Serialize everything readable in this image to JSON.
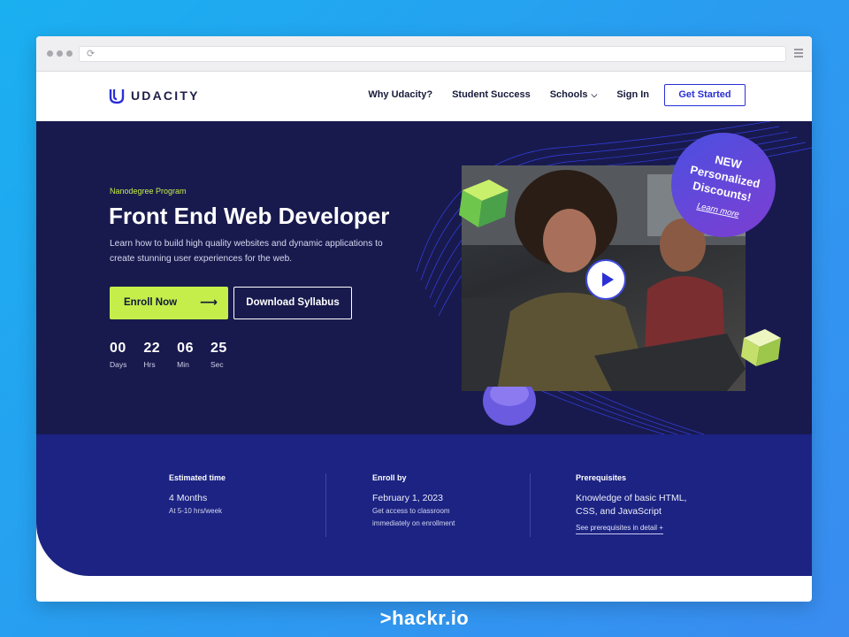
{
  "browser": {
    "reload_icon": "reload-icon",
    "menu_icon": "hamburger-menu-icon"
  },
  "nav": {
    "logo_text": "UDACITY",
    "links": [
      "Why Udacity?",
      "Student Success",
      "Schools",
      "Sign In"
    ],
    "cta": "Get Started"
  },
  "hero": {
    "eyebrow": "Nanodegree Program",
    "title": "Front End Web Developer",
    "description": "Learn how to build high quality websites and dynamic applications to create stunning user experiences for the web.",
    "enroll_label": "Enroll Now",
    "enroll_arrow": "⟶",
    "syllabus_label": "Download Syllabus",
    "countdown": [
      {
        "value": "00",
        "label": "Days"
      },
      {
        "value": "22",
        "label": "Hrs"
      },
      {
        "value": "06",
        "label": "Min"
      },
      {
        "value": "25",
        "label": "Sec"
      }
    ]
  },
  "promo": {
    "line1": "NEW",
    "line2": "Personalized",
    "line3": "Discounts!",
    "link": "Learn more"
  },
  "info": {
    "estimated": {
      "heading": "Estimated time",
      "value": "4 Months",
      "sub": "At 5-10 hrs/week"
    },
    "enroll_by": {
      "heading": "Enroll by",
      "value": "February 1, 2023",
      "sub1": "Get access to classroom",
      "sub2": "immediately on enrollment"
    },
    "prereq": {
      "heading": "Prerequisites",
      "value1": "Knowledge of basic HTML,",
      "value2": "CSS, and JavaScript",
      "link": "See prerequisites in detail +"
    }
  },
  "footer": {
    "brand_prefix": ">",
    "brand": "hackr.io"
  },
  "colors": {
    "hero_bg": "#181a4e",
    "info_bg": "#1c2383",
    "accent_green": "#c5ee4a",
    "accent_blue": "#2a2fd6",
    "page_bg": "#1ab0f0"
  }
}
